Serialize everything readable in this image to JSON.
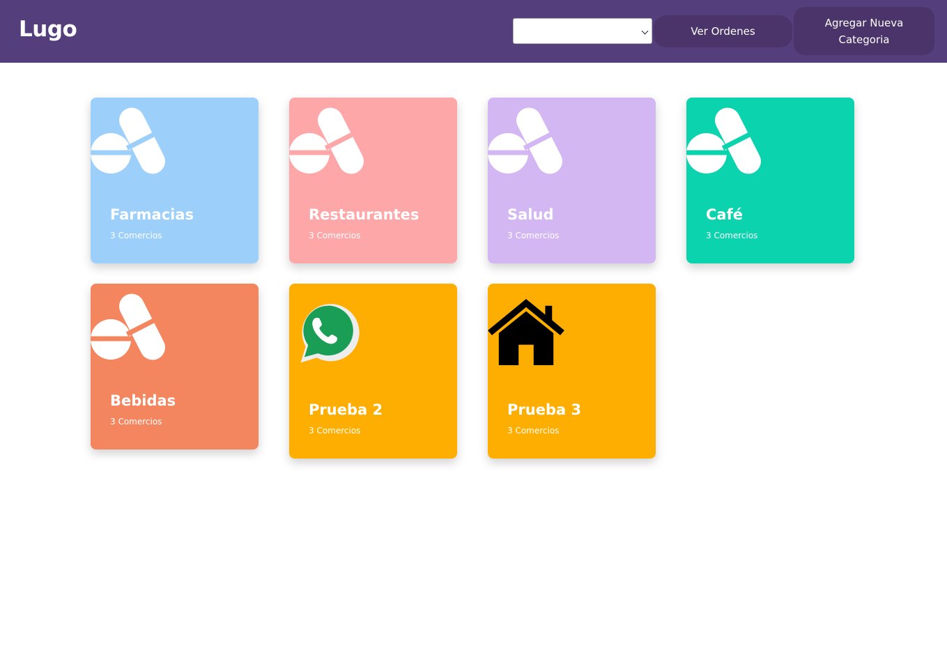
{
  "header": {
    "brand": "Lugo",
    "select_value": "",
    "orders_label": "Ver Ordenes",
    "add_category_label": "Agregar Nueva Categoria",
    "background": "#553e7c",
    "button_color": "#4a3469"
  },
  "categories": [
    {
      "title": "Farmacias",
      "subtitle": "3 Comercios",
      "color": "#9ccffa",
      "icon": "pills-icon"
    },
    {
      "title": "Restaurantes",
      "subtitle": "3 Comercios",
      "color": "#fea7a9",
      "icon": "pills-icon"
    },
    {
      "title": "Salud",
      "subtitle": "3 Comercios",
      "color": "#d3b7f3",
      "icon": "pills-icon"
    },
    {
      "title": "Café",
      "subtitle": "3 Comercios",
      "color": "#0ad3ae",
      "icon": "pills-icon"
    },
    {
      "title": "Bebidas",
      "subtitle": "3 Comercios",
      "color": "#f4865f",
      "icon": "pills-icon"
    },
    {
      "title": "Prueba 2",
      "subtitle": "3 Comercios",
      "color": "#feae00",
      "icon": "whatsapp-icon"
    },
    {
      "title": "Prueba 3",
      "subtitle": "3 Comercios",
      "color": "#feae00",
      "icon": "house-icon"
    }
  ]
}
